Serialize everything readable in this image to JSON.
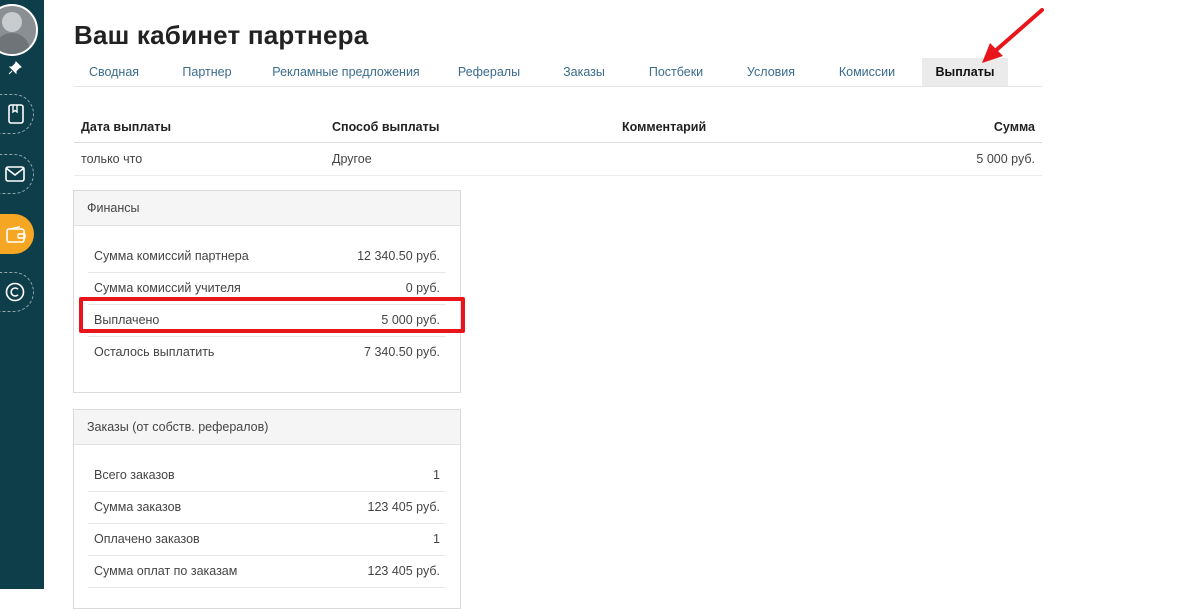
{
  "page": {
    "title": "Ваш кабинет партнера"
  },
  "tabs": [
    {
      "label": "Сводная"
    },
    {
      "label": "Партнер"
    },
    {
      "label": "Рекламные предложения"
    },
    {
      "label": "Рефералы"
    },
    {
      "label": "Заказы"
    },
    {
      "label": "Постбеки"
    },
    {
      "label": "Условия"
    },
    {
      "label": "Комиссии"
    },
    {
      "label": "Выплаты",
      "active": true
    }
  ],
  "payouts": {
    "headers": {
      "date": "Дата выплаты",
      "method": "Способ выплаты",
      "comment": "Комментарий",
      "amount": "Сумма"
    },
    "rows": [
      {
        "date": "только что",
        "method": "Другое",
        "comment": "",
        "amount": "5 000 руб."
      }
    ]
  },
  "finance": {
    "title": "Финансы",
    "rows": [
      {
        "label": "Сумма комиссий партнера",
        "value": "12 340.50 руб."
      },
      {
        "label": "Сумма комиссий учителя",
        "value": "0 руб."
      },
      {
        "label": "Выплачено",
        "value": "5 000 руб."
      },
      {
        "label": "Осталось выплатить",
        "value": "7 340.50 руб."
      }
    ]
  },
  "orders": {
    "title": "Заказы (от собств. рефералов)",
    "rows": [
      {
        "label": "Всего заказов",
        "value": "1"
      },
      {
        "label": "Сумма заказов",
        "value": "123 405 руб."
      },
      {
        "label": "Оплачено заказов",
        "value": "1"
      },
      {
        "label": "Сумма оплат по заказам",
        "value": "123 405 руб."
      }
    ]
  },
  "sidebar": {
    "icons": [
      "avatar",
      "pin-icon",
      "book-icon",
      "mail-icon",
      "wallet-icon",
      "copyright-icon"
    ],
    "active": "wallet-icon"
  },
  "colors": {
    "sidebar": "#0f3e4b",
    "accent": "#f5a623",
    "annotation": "#e8151b",
    "link": "#3a6c8e"
  }
}
